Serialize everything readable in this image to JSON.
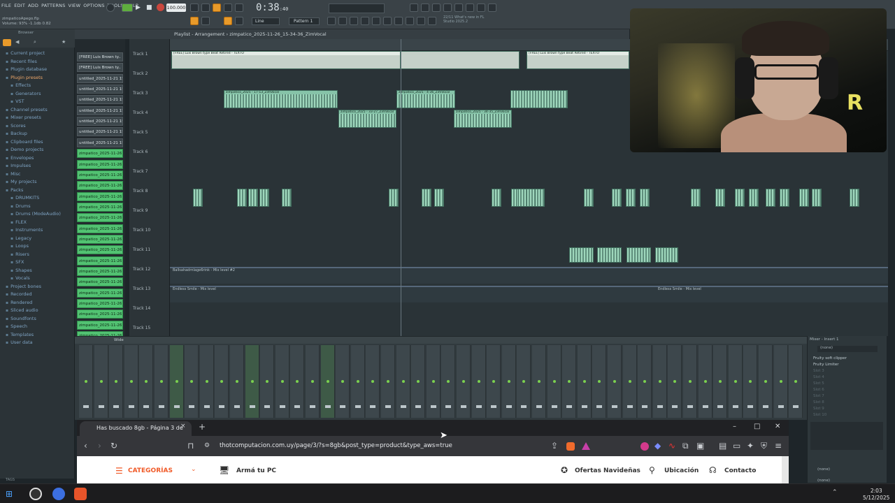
{
  "daw": {
    "menu": [
      "FILE",
      "EDIT",
      "ADD",
      "PATTERNS",
      "VIEW",
      "OPTIONS",
      "TOOLS",
      "HELP"
    ],
    "project_file": "zimpaticoApego.flp",
    "volume_line": "Volume: 93%  -1.1db  0.82",
    "tempo": "100.000",
    "time": "0:38",
    "time_frac": ":40",
    "pattern": "Pattern 1",
    "mode": "Line",
    "news_line1": "22/11  What's new in FL",
    "news_line2": "Studio 2025.2",
    "playlist_title": "Playlist - Arrangement  ›  zimpatico_2025-11-26_15-34-36_ZimVocal",
    "browser_title": "Browser"
  },
  "browser_items": [
    {
      "label": "Current project",
      "sub": false,
      "sel": false
    },
    {
      "label": "Recent files",
      "sub": false,
      "sel": false
    },
    {
      "label": "Plugin database",
      "sub": false,
      "sel": false
    },
    {
      "label": "Plugin presets",
      "sub": false,
      "sel": true
    },
    {
      "label": "Effects",
      "sub": true,
      "sel": false
    },
    {
      "label": "Generators",
      "sub": true,
      "sel": false
    },
    {
      "label": "VST",
      "sub": true,
      "sel": false
    },
    {
      "label": "Channel presets",
      "sub": false,
      "sel": false
    },
    {
      "label": "Mixer presets",
      "sub": false,
      "sel": false
    },
    {
      "label": "Scores",
      "sub": false,
      "sel": false
    },
    {
      "label": "Backup",
      "sub": false,
      "sel": false
    },
    {
      "label": "Clipboard files",
      "sub": false,
      "sel": false
    },
    {
      "label": "Demo projects",
      "sub": false,
      "sel": false
    },
    {
      "label": "Envelopes",
      "sub": false,
      "sel": false
    },
    {
      "label": "Impulses",
      "sub": false,
      "sel": false
    },
    {
      "label": "Misc",
      "sub": false,
      "sel": false
    },
    {
      "label": "My projects",
      "sub": false,
      "sel": false
    },
    {
      "label": "Packs",
      "sub": false,
      "sel": false
    },
    {
      "label": "DRUMKITS",
      "sub": true,
      "sel": false
    },
    {
      "label": "Drums",
      "sub": true,
      "sel": false
    },
    {
      "label": "Drums (ModeAudio)",
      "sub": true,
      "sel": false
    },
    {
      "label": "FLEX",
      "sub": true,
      "sel": false
    },
    {
      "label": "Instruments",
      "sub": true,
      "sel": false
    },
    {
      "label": "Legacy",
      "sub": true,
      "sel": false
    },
    {
      "label": "Loops",
      "sub": true,
      "sel": false
    },
    {
      "label": "Risers",
      "sub": true,
      "sel": false
    },
    {
      "label": "SFX",
      "sub": true,
      "sel": false
    },
    {
      "label": "Shapes",
      "sub": true,
      "sel": false
    },
    {
      "label": "Vocals",
      "sub": true,
      "sel": false
    },
    {
      "label": "Project bones",
      "sub": false,
      "sel": false
    },
    {
      "label": "Recorded",
      "sub": false,
      "sel": false
    },
    {
      "label": "Rendered",
      "sub": false,
      "sel": false
    },
    {
      "label": "Sliced audio",
      "sub": false,
      "sel": false
    },
    {
      "label": "Soundfonts",
      "sub": false,
      "sel": false
    },
    {
      "label": "Speech",
      "sub": false,
      "sel": false
    },
    {
      "label": "Templates",
      "sub": false,
      "sel": false
    },
    {
      "label": "User data",
      "sub": false,
      "sel": false
    }
  ],
  "channels": [
    {
      "label": "[FREE] Luis Brown ty..",
      "green": false
    },
    {
      "label": "[FREE] Luis Brown ty..",
      "green": false
    },
    {
      "label": "untitled_2025-11-21 15..",
      "green": false
    },
    {
      "label": "untitled_2025-11-21 15..",
      "green": false
    },
    {
      "label": "untitled_2025-11-21 15..",
      "green": false
    },
    {
      "label": "untitled_2025-11-21 15..",
      "green": false
    },
    {
      "label": "untitled_2025-11-21 15..",
      "green": false
    },
    {
      "label": "untitled_2025-11-21 15..",
      "green": false
    },
    {
      "label": "untitled_2025-11-21 15..",
      "green": false
    },
    {
      "label": "zimpatico_2025-11-26 1..",
      "green": true
    },
    {
      "label": "zimpatico_2025-11-26 1..",
      "green": true
    },
    {
      "label": "zimpatico_2025-11-26 1..",
      "green": true
    },
    {
      "label": "zimpatico_2025-11-26 1..",
      "green": true
    },
    {
      "label": "zimpatico_2025-11-26 1..",
      "green": true
    },
    {
      "label": "zimpatico_2025-11-26 1..",
      "green": true
    },
    {
      "label": "zimpatico_2025-11-26 1..",
      "green": true
    },
    {
      "label": "zimpatico_2025-11-26 1..",
      "green": true
    },
    {
      "label": "zimpatico_2025-11-26 1..",
      "green": true
    },
    {
      "label": "zimpatico_2025-11-26 1..",
      "green": true
    },
    {
      "label": "zimpatico_2025-11-26 1..",
      "green": true
    },
    {
      "label": "zimpatico_2025-11-26 1..",
      "green": true
    },
    {
      "label": "zimpatico_2025-11-26 1..",
      "green": true
    },
    {
      "label": "zimpatico_2025-11-26 1..",
      "green": true
    },
    {
      "label": "zimpatico_2025-11-26 1..",
      "green": true
    },
    {
      "label": "zimpatico_2025-11-26 1..",
      "green": true
    },
    {
      "label": "zimpatico_2025-11-26 1..",
      "green": true
    },
    {
      "label": "zimpatico_2025-11-26 1..",
      "green": true
    }
  ],
  "tracks": [
    "Track 1",
    "Track 2",
    "Track 3",
    "Track 4",
    "Track 5",
    "Track 6",
    "Track 7",
    "Track 8",
    "Track 9",
    "Track 10",
    "Track 11",
    "Track 12",
    "Track 13",
    "Track 14",
    "Track 15"
  ],
  "clip_labels": {
    "beat": "[FREE] Luis Brown type Beat Retired - TEXTO",
    "beat2": "[FREE] Luis Brown type Beat Retired - TEXTO",
    "vocal_a": "zimpatico_2025 - 17-13_ZimVocal",
    "vocal_b": "zimpatico_2025 - 4-36_ZimVocal",
    "vocal_c": "zimpatico_2025 - 33-27_ZimVocal",
    "vocal_d": "zimpatico_2025 - 34-35_ZimVocal",
    "auto1": "Ballsahadrnlage6rink - Mix level #2",
    "auto2": "Endless Smile - Mix level",
    "auto3": "Endless Smile - Mix level"
  },
  "mixer": {
    "title": "Wide",
    "insert_title": "Mixer - Insert 1",
    "insert_none_top": "(none)",
    "slots": [
      "Fruity soft clipper",
      "Fruity Limiter",
      "Slot 3",
      "Slot 4",
      "Slot 5",
      "Slot 6",
      "Slot 7",
      "Slot 8",
      "Slot 9",
      "Slot 10"
    ],
    "insert_none_1": "(none)",
    "insert_none_2": "(none)"
  },
  "chrome": {
    "tab_title": "Has buscado 8gb - Página 3 de",
    "url": "thotcomputacion.com.uy/page/3/?s=8gb&post_type=product&type_aws=true",
    "categorias": "CATEGORÍAS",
    "arma": "Armá tu PC",
    "ofertas": "Ofertas Navideñas",
    "ubicacion": "Ubicación",
    "contacto": "Contacto"
  },
  "taskbar": {
    "time": "2:03",
    "date": "5/12/2025",
    "tags": "TAGS"
  },
  "colors": {
    "accent_orange": "#e89a2a",
    "clip_green": "#86c3a8",
    "chan_green": "#52c272",
    "brand_orange": "#f05a28"
  }
}
